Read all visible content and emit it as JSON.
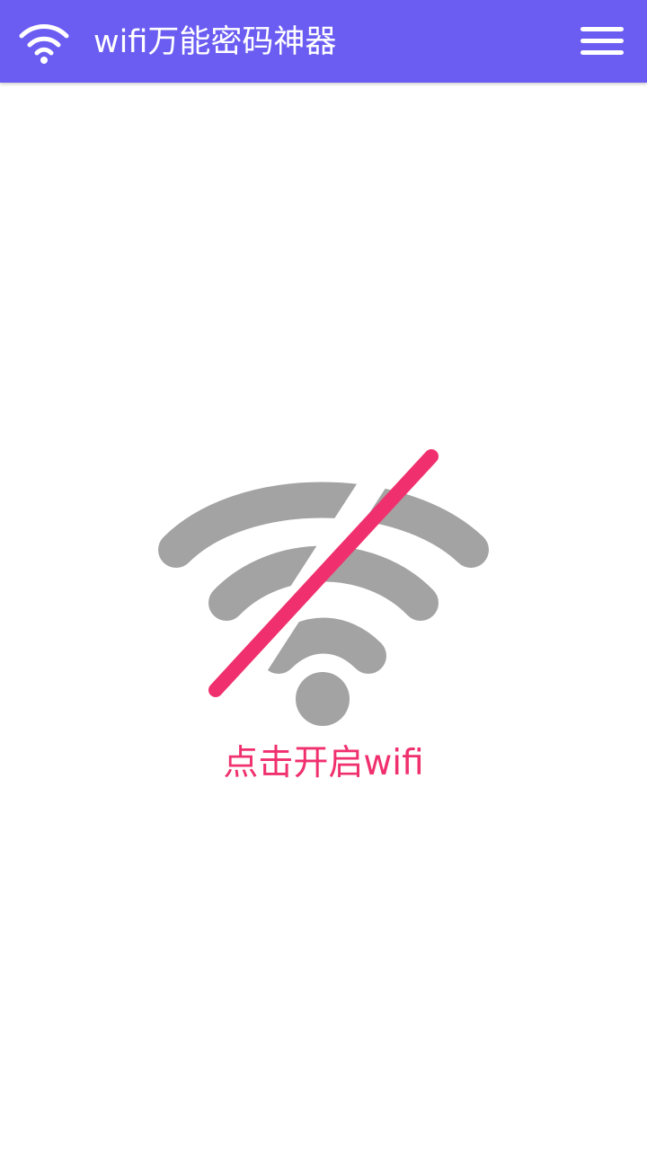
{
  "app": {
    "title": "wifi万能密码神器",
    "logo_icon": "wifi-icon",
    "menu_icon": "hamburger-menu-icon"
  },
  "main": {
    "status_icon": "wifi-off-icon",
    "action_label": "点击开启wifi"
  },
  "colors": {
    "topbar": "#6b5df2",
    "icon_gray": "#a3a3a3",
    "accent_pink": "#f0306e",
    "background": "#ffffff"
  }
}
